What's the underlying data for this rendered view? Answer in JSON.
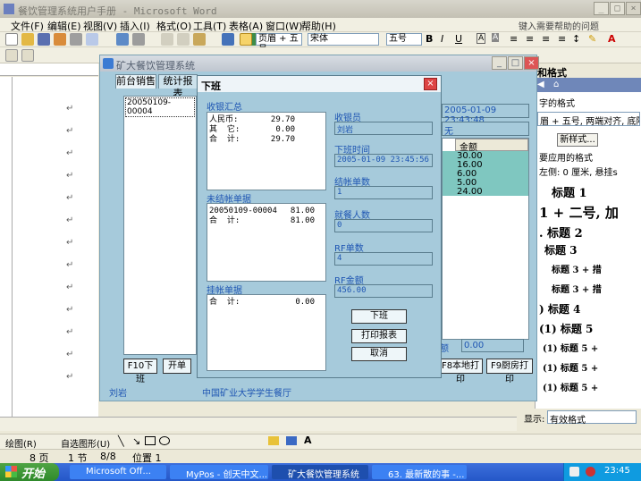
{
  "word": {
    "title": "餐饮管理系统用户手册 - Microsoft Word",
    "menu": [
      "文件(F)",
      "编辑(E)",
      "视图(V)",
      "插入(I)",
      "格式(O)",
      "工具(T)",
      "表格(A)",
      "窗口(W)",
      "帮助(H)"
    ],
    "help_placeholder": "键入需要帮助的问题",
    "style_box": "页眉 + 五号",
    "font_box": "宋体",
    "size_box": "五号",
    "pane_title": "和格式",
    "pane_selected_label": "字的格式",
    "pane_selected_value": "眉 + 五号, 两端对齐, 底除",
    "pane_new_style": "新样式...",
    "pane_applied_label": "要应用的格式",
    "pane_items": [
      "左侧: 0 厘米, 悬挂s",
      "标题 1",
      "1 + 二号, 加",
      ". 标题 2",
      "标题 3",
      "标题 3 + 措",
      "标题 3 + 措",
      ") 标题 4",
      "(1) 标题 5",
      "(1)   标题 5 +",
      "(1)   标题 5 +",
      "(1)   标题 5 +"
    ],
    "pane_show_label": "显示:",
    "pane_show_value": "有效格式",
    "drawbar": {
      "draw": "绘图(R)",
      "autoshape": "自选图形(U)"
    },
    "status": {
      "page": "8 页",
      "section": "1 节",
      "count": "8/8",
      "position": "位置 1"
    }
  },
  "taskbar": {
    "start": "开始",
    "tasks": [
      "Microsoft Off...",
      "MyPos - 创天中文...",
      "矿大餐饮管理系统",
      "63. 最新散的事 -..."
    ],
    "clock": "23:45"
  },
  "app": {
    "title": "矿大餐饮管理系统",
    "tabs": [
      "前台销售",
      "统计报表"
    ],
    "list_item": "20050109-00004",
    "btn_f10": "F10下班",
    "btn_switch": "开单",
    "datetime": "2005-01-09 23:43:48",
    "none_text": "无",
    "amount_header": "金额",
    "amounts": [
      "30.00",
      "16.00",
      "6.00",
      "5.00",
      "24.00"
    ],
    "total_label": "额",
    "total_value": "0.00",
    "btn_local_print": "F8本地打印",
    "btn_kitchen_print": "F9厨房打印",
    "footer_user": "刘岩",
    "footer_org": "中国矿业大学学生餐厅"
  },
  "dialog": {
    "title": "下班",
    "summary_label": "收银汇总",
    "summary_rows": [
      {
        "label": "人民币:",
        "value": "29.70"
      },
      {
        "label": "其  它:",
        "value": "0.00"
      },
      {
        "label": "合  计:",
        "value": "29.70"
      }
    ],
    "unpaid_label": "未结帐单据",
    "unpaid_rows": [
      {
        "label": "20050109-00004",
        "value": "81.00"
      },
      {
        "label": "合  计:",
        "value": "81.00"
      }
    ],
    "hung_label": "挂帐单据",
    "hung_rows": [
      {
        "label": "合  计:",
        "value": "0.00"
      }
    ],
    "cashier_label": "收银员",
    "cashier_value": "刘岩",
    "offtime_label": "下班时间",
    "offtime_value": "2005-01-09 23:45:56",
    "bills_label": "结帐单数",
    "bills_value": "1",
    "diners_label": "就餐人数",
    "diners_value": "0",
    "rf_count_label": "RF单数",
    "rf_count_value": "4",
    "rf_amount_label": "RF金额",
    "rf_amount_value": "456.00",
    "btn_off": "下班",
    "btn_print": "打印报表",
    "btn_cancel": "取消"
  }
}
